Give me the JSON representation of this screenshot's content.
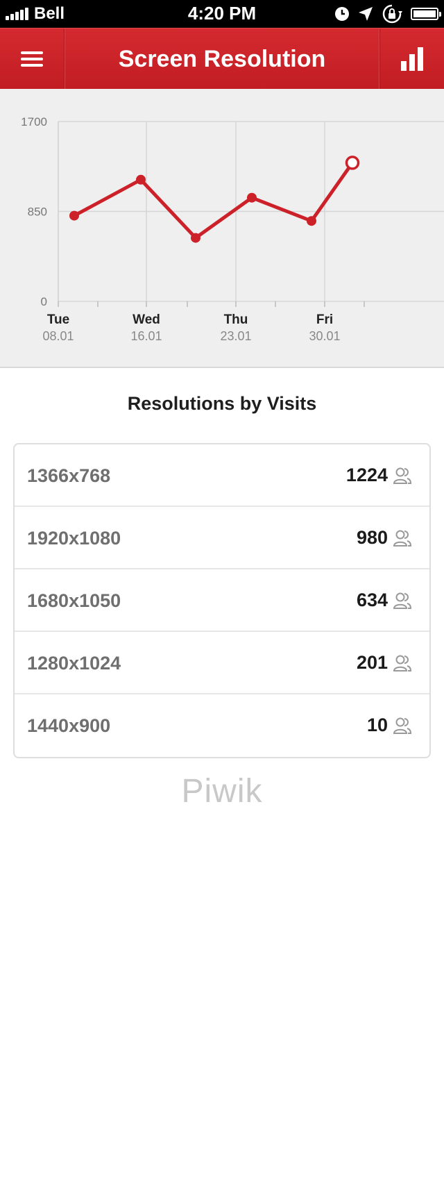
{
  "status_bar": {
    "carrier": "Bell",
    "time": "4:20 PM"
  },
  "header": {
    "title": "Screen Resolution",
    "menu_icon": "hamburger-menu-icon",
    "chart_icon": "bar-chart-icon"
  },
  "chart_data": {
    "type": "line",
    "x_ticks": [
      {
        "day": "Tue",
        "date": "08.01"
      },
      {
        "day": "Wed",
        "date": "16.01"
      },
      {
        "day": "Thu",
        "date": "23.01"
      },
      {
        "day": "Fri",
        "date": "30.01"
      }
    ],
    "y_ticks": [
      "1700",
      "850",
      "0"
    ],
    "ylim": [
      0,
      1700
    ],
    "points": [
      810,
      1150,
      600,
      980,
      760,
      1310
    ],
    "last_point_hollow": true,
    "color": "#cc2129",
    "grid": true
  },
  "section": {
    "title": "Resolutions by Visits"
  },
  "rows": [
    {
      "resolution": "1366x768",
      "visits": "1224"
    },
    {
      "resolution": "1920x1080",
      "visits": "980"
    },
    {
      "resolution": "1680x1050",
      "visits": "634"
    },
    {
      "resolution": "1280x1024",
      "visits": "201"
    },
    {
      "resolution": "1440x900",
      "visits": "10"
    }
  ],
  "footer": {
    "logo": "Piwik"
  },
  "colors": {
    "accent": "#cc2129",
    "chart_bg": "#efefef"
  }
}
